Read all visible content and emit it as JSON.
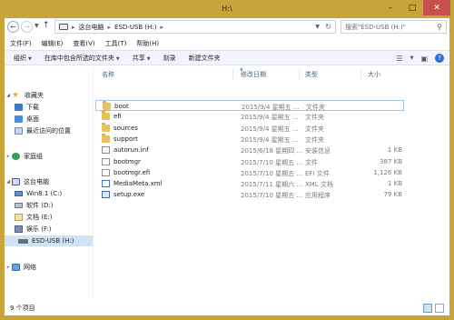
{
  "window": {
    "title": "H:\\"
  },
  "address": {
    "segments": [
      "这台电脑",
      "ESD-USB (H:)"
    ]
  },
  "search": {
    "placeholder": "搜索\"ESD-USB (H:)\""
  },
  "menu": [
    "文件(F)",
    "编辑(E)",
    "查看(V)",
    "工具(T)",
    "帮助(H)"
  ],
  "toolbar": [
    "组织",
    "在库中包含所选的文件夹",
    "共享",
    "刻录",
    "新建文件夹"
  ],
  "sidebar": {
    "favorites": "收藏夹",
    "downloads": "下载",
    "desktop": "桌面",
    "recent": "最近访问的位置",
    "homegroup": "家庭组",
    "this_pc": "这台电脑",
    "drives": [
      "Win8.1 (C:)",
      "软件 (D:)",
      "文档 (E:)",
      "娱乐 (F:)",
      "ESD-USB (H:)"
    ],
    "network": "网络"
  },
  "columns": {
    "name": "名称",
    "date": "修改日期",
    "type": "类型",
    "size": "大小"
  },
  "files": [
    {
      "name": "boot",
      "date": "2015/9/4 星期五 ...",
      "type": "文件夹",
      "size": "",
      "icon": "folder"
    },
    {
      "name": "efi",
      "date": "2015/9/4 星期五 ...",
      "type": "文件夹",
      "size": "",
      "icon": "folder"
    },
    {
      "name": "sources",
      "date": "2015/9/4 星期五 ...",
      "type": "文件夹",
      "size": "",
      "icon": "folder"
    },
    {
      "name": "support",
      "date": "2015/9/4 星期五 ...",
      "type": "文件夹",
      "size": "",
      "icon": "folder"
    },
    {
      "name": "autorun.inf",
      "date": "2015/6/18 星期四 ...",
      "type": "安装信息",
      "size": "1 KB",
      "icon": "inf"
    },
    {
      "name": "bootmgr",
      "date": "2015/7/10 星期五 ...",
      "type": "文件",
      "size": "387 KB",
      "icon": "doc"
    },
    {
      "name": "bootmgr.efi",
      "date": "2015/7/10 星期五 ...",
      "type": "EFI 文件",
      "size": "1,126 KB",
      "icon": "efi"
    },
    {
      "name": "MediaMeta.xml",
      "date": "2015/7/11 星期六 ...",
      "type": "XML 文档",
      "size": "1 KB",
      "icon": "xml"
    },
    {
      "name": "setup.exe",
      "date": "2015/7/10 星期五 ...",
      "type": "应用程序",
      "size": "79 KB",
      "icon": "exe"
    }
  ],
  "status": {
    "count": "9 个项目"
  }
}
